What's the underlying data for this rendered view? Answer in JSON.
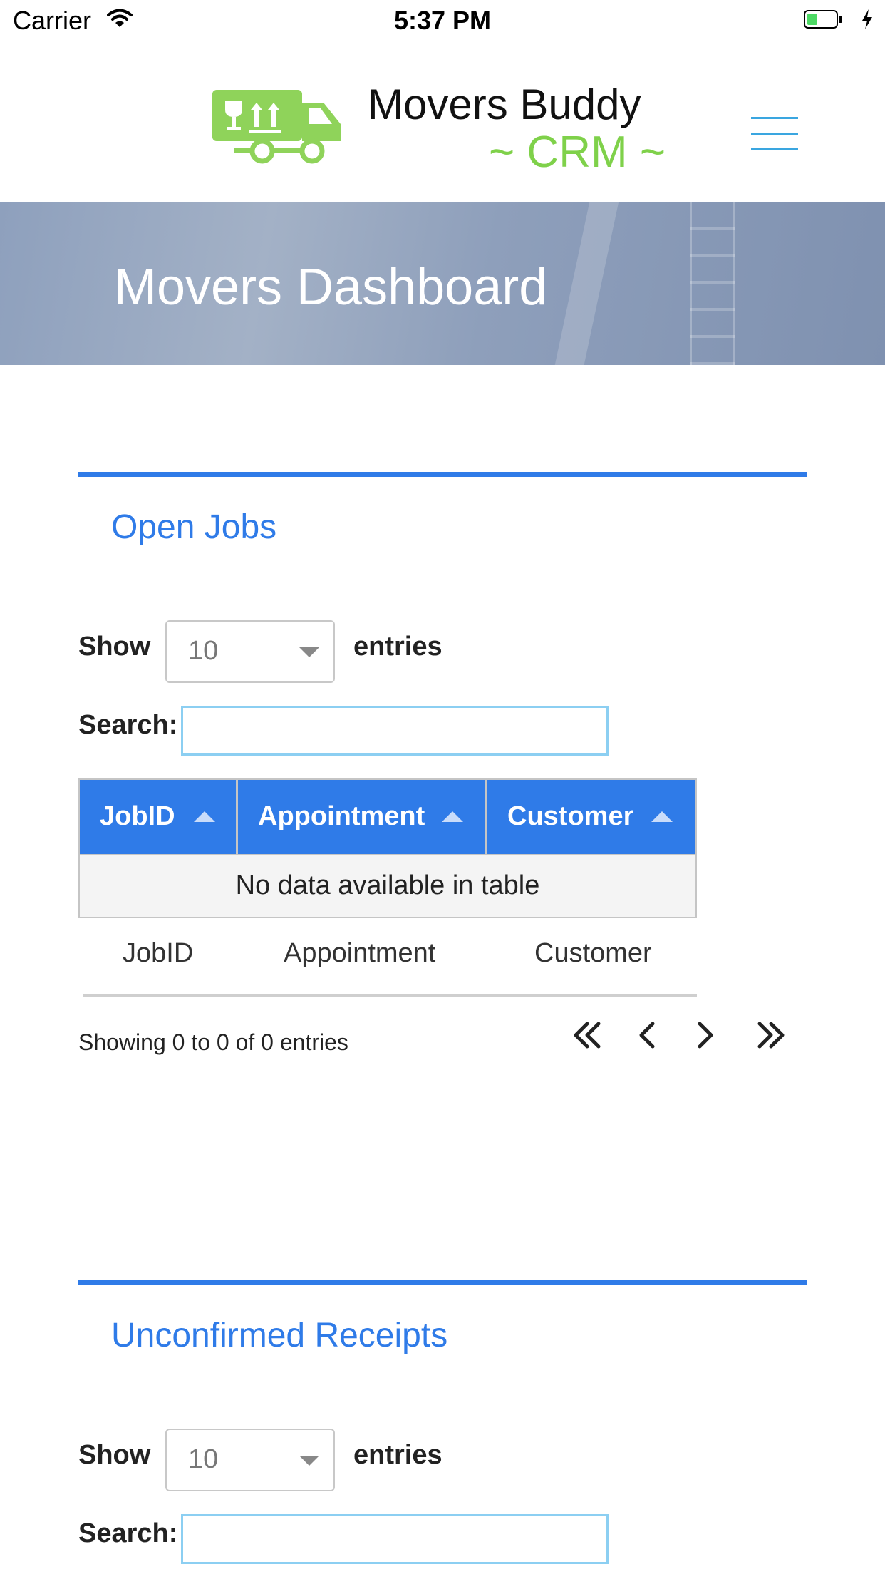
{
  "status_bar": {
    "carrier": "Carrier",
    "time": "5:37 PM",
    "battery_level": 0.35
  },
  "header": {
    "brand_name": "Movers Buddy",
    "brand_sub": "~ CRM ~",
    "menu_icon": "hamburger-icon",
    "brand_color": "#7fd14a"
  },
  "hero": {
    "title": "Movers Dashboard"
  },
  "colors": {
    "accent": "#2f7be8",
    "search_border": "#8ccff2"
  },
  "open_jobs": {
    "title": "Open Jobs",
    "show_label": "Show",
    "entries_value": "10",
    "entries_label": "entries",
    "search_label": "Search:",
    "search_value": "",
    "columns": [
      "JobID",
      "Appointment",
      "Customer"
    ],
    "empty_message": "No data available in table",
    "footer_columns": [
      "JobID",
      "Appointment",
      "Customer"
    ],
    "info": "Showing 0 to 0 of 0 entries",
    "pager_icons": [
      "first-page-icon",
      "previous-page-icon",
      "next-page-icon",
      "last-page-icon"
    ]
  },
  "unconfirmed_receipts": {
    "title": "Unconfirmed Receipts",
    "show_label": "Show",
    "entries_value": "10",
    "entries_label": "entries",
    "search_label": "Search:",
    "search_value": ""
  }
}
